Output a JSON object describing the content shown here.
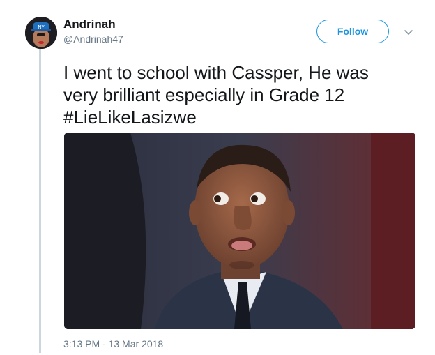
{
  "user": {
    "name": "Andrinah",
    "handle": "@Andrinah47"
  },
  "actions": {
    "follow_label": "Follow",
    "more_icon": "chevron-down-icon"
  },
  "tweet": {
    "line1": "I went to school with Cassper, He was",
    "line2": "very brilliant especially in Grade 12",
    "hashtag": "#LieLikeLasizwe",
    "timestamp": "3:13 PM - 13 Mar 2018"
  },
  "colors": {
    "accent": "#1b95e0",
    "secondary_text": "#657786",
    "thread_line": "#ccd6dd"
  }
}
